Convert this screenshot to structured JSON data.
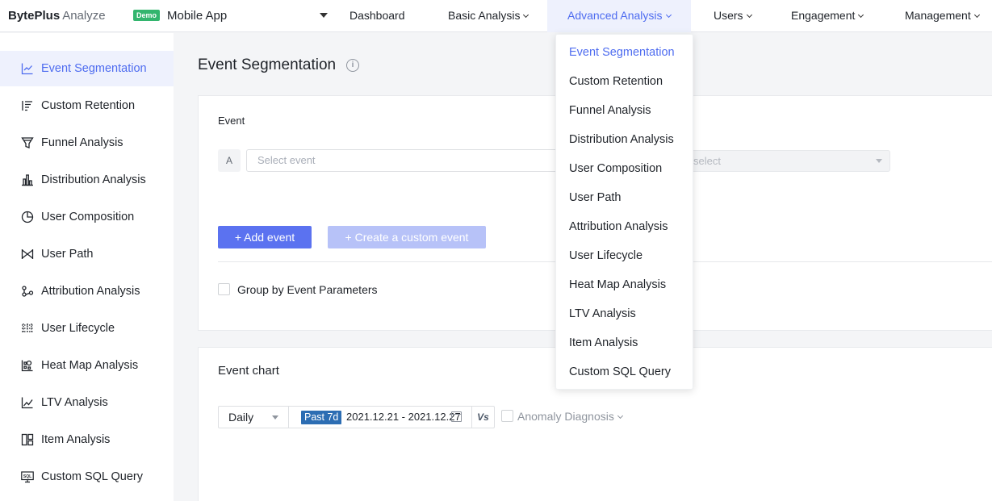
{
  "brand": {
    "name_bold": "BytePlus",
    "name_light": "Analyze"
  },
  "project": {
    "badge": "Demo",
    "name": "Mobile App"
  },
  "top_nav": [
    {
      "label": "Dashboard"
    },
    {
      "label": "Basic Analysis"
    },
    {
      "label": "Advanced Analysis"
    },
    {
      "label": "Users"
    },
    {
      "label": "Engagement"
    },
    {
      "label": "Management"
    }
  ],
  "sidebar": {
    "items": [
      {
        "label": "Event Segmentation",
        "icon": "line-chart-icon"
      },
      {
        "label": "Custom Retention",
        "icon": "retention-bars-icon"
      },
      {
        "label": "Funnel Analysis",
        "icon": "funnel-icon"
      },
      {
        "label": "Distribution Analysis",
        "icon": "bar-chart-icon"
      },
      {
        "label": "User Composition",
        "icon": "pie-chart-icon"
      },
      {
        "label": "User Path",
        "icon": "path-icon"
      },
      {
        "label": "Attribution Analysis",
        "icon": "attribution-icon"
      },
      {
        "label": "User Lifecycle",
        "icon": "lifecycle-icon"
      },
      {
        "label": "Heat Map Analysis",
        "icon": "heatmap-icon"
      },
      {
        "label": "LTV Analysis",
        "icon": "trend-icon"
      },
      {
        "label": "Item Analysis",
        "icon": "item-icon"
      },
      {
        "label": "Custom SQL Query",
        "icon": "sql-icon"
      }
    ]
  },
  "main": {
    "title": "Event Segmentation",
    "event_section": {
      "label": "Event",
      "row_letter": "A",
      "select_placeholder": "Select event",
      "right_select_placeholder": "select",
      "add_event_label": "+ Add event",
      "custom_event_label": "+ Create a custom event",
      "group_by_label": "Group by Event Parameters"
    },
    "chart_section": {
      "title": "Event chart",
      "granularity": "Daily",
      "preset": "Past 7d",
      "date_range": "2021.12.21 - 2021.12.27",
      "vs_label": "Vs",
      "anomaly_label": "Anomaly Diagnosis"
    }
  },
  "dropdown": {
    "items": [
      "Event Segmentation",
      "Custom Retention",
      "Funnel Analysis",
      "Distribution Analysis",
      "User Composition",
      "User Path",
      "Attribution Analysis",
      "User Lifecycle",
      "Heat Map Analysis",
      "LTV Analysis",
      "Item Analysis",
      "Custom SQL Query"
    ]
  },
  "colors": {
    "accent": "#4e6cf0",
    "demo_badge": "#33b56e",
    "preset_badge": "#2c6db3"
  }
}
